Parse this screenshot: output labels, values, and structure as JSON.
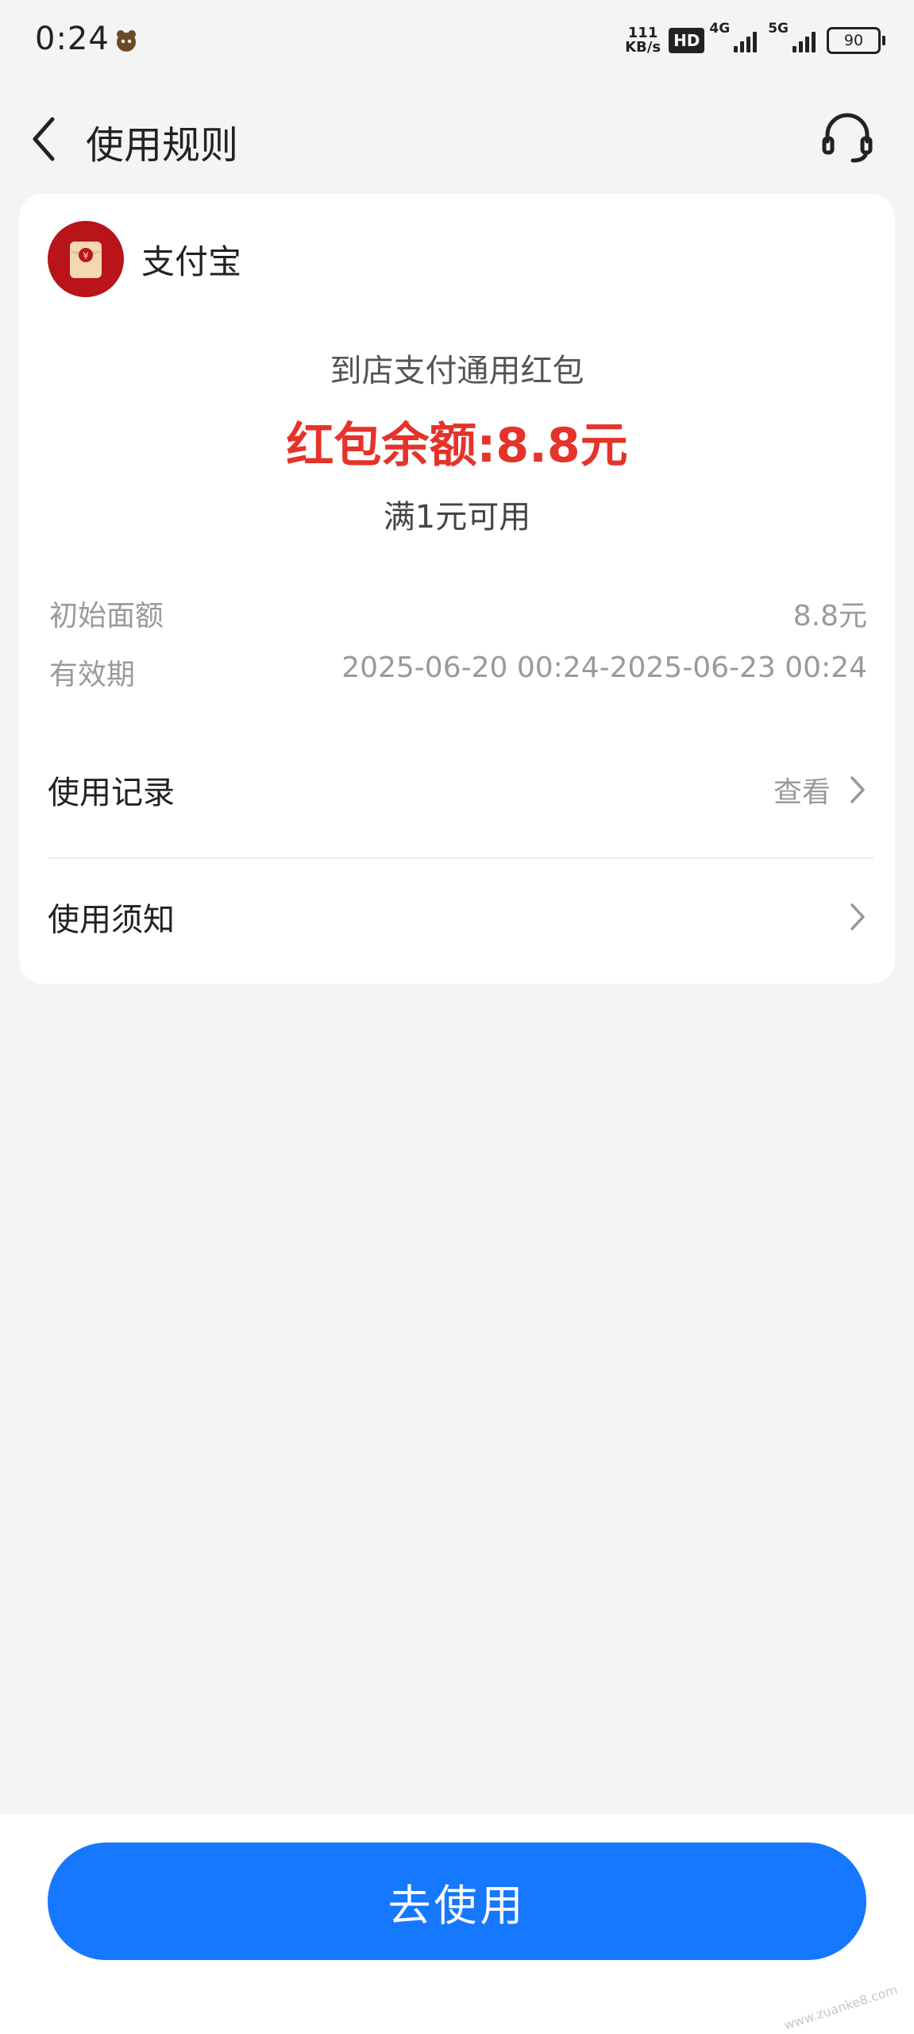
{
  "status_bar": {
    "time": "0:24",
    "net_speed_value": "111",
    "net_speed_unit": "KB/s",
    "hd_badge": "HD",
    "network_1": "4G",
    "network_2": "5G",
    "battery": "90"
  },
  "nav": {
    "title": "使用规则",
    "back_icon": "chevron-left-icon",
    "support_icon": "headset-icon"
  },
  "card": {
    "brand_name": "支付宝",
    "brand_icon": "red-envelope-icon",
    "coupon_type": "到店支付通用红包",
    "balance": "红包余额:8.8元",
    "threshold": "满1元可用",
    "initial_label": "初始面额",
    "initial_value": "8.8元",
    "validity_label": "有效期",
    "validity_value": "2025-06-20 00:24-2025-06-23 00:24",
    "records_label": "使用记录",
    "records_action": "查看",
    "notice_label": "使用须知"
  },
  "bottom": {
    "use_button": "去使用",
    "watermark": "www.zuanke8.com"
  },
  "colors": {
    "accent": "#1677ff",
    "balance_red": "#e5332a",
    "brand_red": "#b8141a",
    "background": "#f4f4f4"
  }
}
